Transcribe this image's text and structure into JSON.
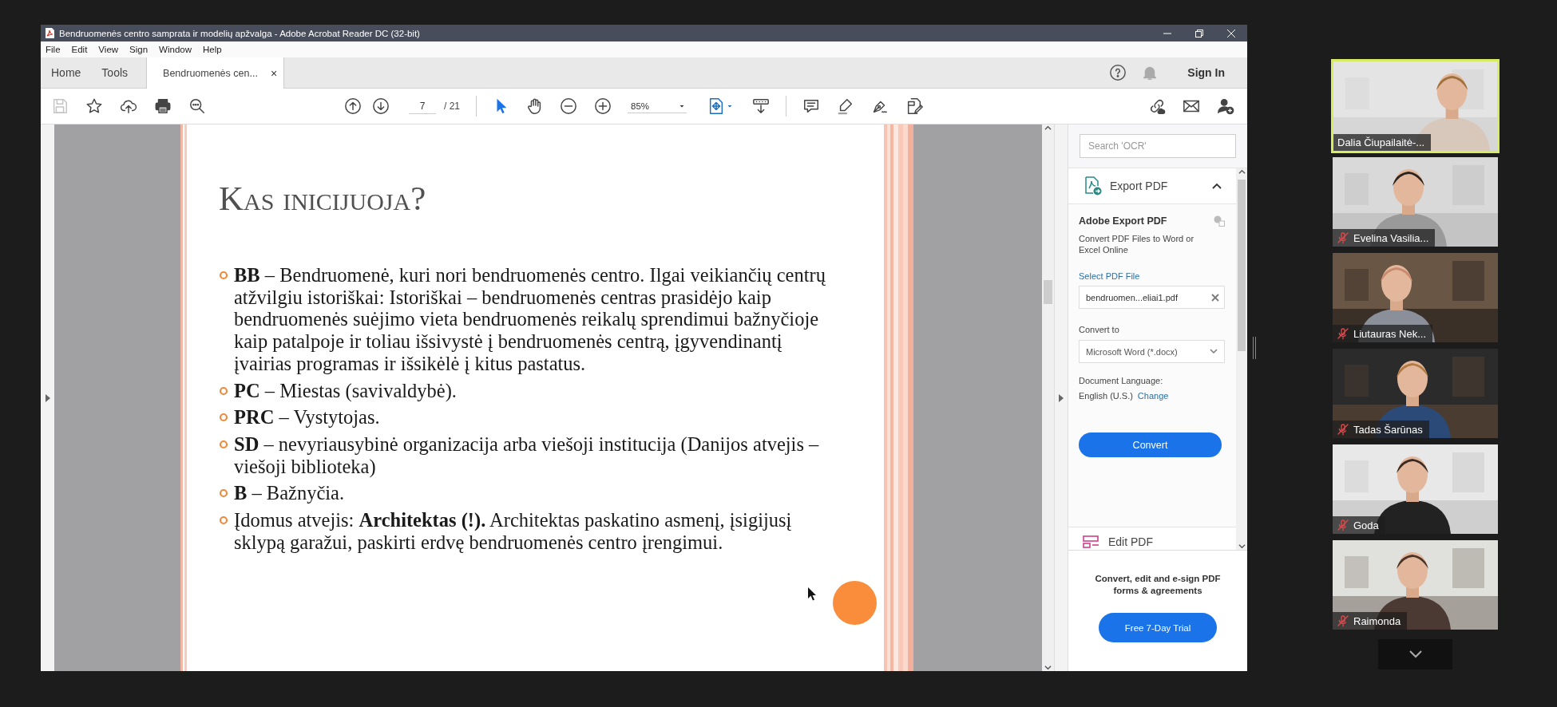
{
  "window": {
    "title": "Bendruomenės centro samprata ir modelių apžvalga - Adobe Acrobat Reader DC (32-bit)"
  },
  "menu": [
    "File",
    "Edit",
    "View",
    "Sign",
    "Window",
    "Help"
  ],
  "tabs": [
    {
      "label": "Home",
      "selected": false
    },
    {
      "label": "Tools",
      "selected": false
    },
    {
      "label": "Bendruomenės cen...",
      "selected": true,
      "close": "×"
    }
  ],
  "sign_in": "Sign In",
  "toolbar": {
    "save_disabled": true,
    "page": "7",
    "page_total": "/ 21",
    "zoom": "85%",
    "pointer_tools": [
      {
        "kind": "select",
        "selected": true
      },
      {
        "kind": "hand",
        "selected": false
      }
    ]
  },
  "slide": {
    "title": "Kas inicijuoja?",
    "bullets": [
      "**BB** – Bendruomenė, kuri nori bendruomenės centro. Ilgai veikiančių centrų atžvilgiu istoriškai:  Istoriškai – bendruomenės centras prasidėjo kaip bendruomenės suėjimo vieta bendruomenės reikalų sprendimui bažnyčioje kaip patalpoje ir toliau išsivystė į bendruomenės centrą, įgyvendinantį įvairias programas ir išsikėlė į kitus pastatus.",
      "**PC** – Miestas (savivaldybė).",
      "**PRC** – Vystytojas.",
      "**SD** – nevyriausybinė organizacija arba viešoji institucija (Danijos atvejis – viešoji biblioteka)",
      "**B** – Bažnyčia.",
      "Įdomus atvejis: **Architektas (!).** Architektas paskatino asmenį, įsigijusį sklypą garažui, paskirti erdvę bendruomenės centro įrengimui."
    ]
  },
  "side_pane": {
    "search_placeholder": "Search 'OCR'",
    "section": "Export PDF",
    "expanded": true,
    "heading": "Adobe Export PDF",
    "description": "Convert PDF Files to Word or Excel Online",
    "select_label": "Select PDF File",
    "file": "bendruomen...eliai1.pdf",
    "convert_to_label": "Convert to",
    "format": "Microsoft Word (*.docx)",
    "language_label": "Document Language:",
    "language": "English (U.S.)",
    "change_link": "Change",
    "convert_button": "Convert",
    "next_section": "Edit PDF",
    "promo": "Convert, edit and e-sign PDF forms & agreements",
    "trial_button": "Free 7-Day Trial"
  },
  "participants": [
    {
      "name": "Dalia Čiupailaitė-...",
      "muted": false,
      "speaking": true
    },
    {
      "name": "Evelina Vasilia...",
      "muted": true,
      "speaking": false
    },
    {
      "name": "Liutauras Nek...",
      "muted": true,
      "speaking": false
    },
    {
      "name": "Tadas Šarūnas",
      "muted": true,
      "speaking": false
    },
    {
      "name": "Goda",
      "muted": true,
      "speaking": false
    },
    {
      "name": "Raimonda",
      "muted": true,
      "speaking": false
    }
  ]
}
